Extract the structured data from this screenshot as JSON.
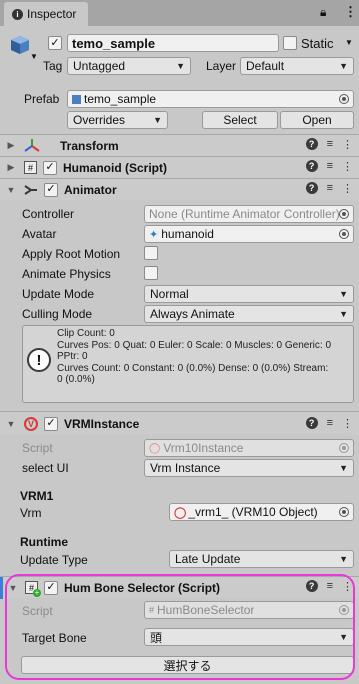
{
  "tab": {
    "title": "Inspector"
  },
  "object": {
    "name": "temo_sample",
    "static_label": "Static",
    "tag_label": "Tag",
    "tag_value": "Untagged",
    "layer_label": "Layer",
    "layer_value": "Default",
    "prefab_label": "Prefab",
    "prefab_value": "temo_sample",
    "overrides": "Overrides",
    "select": "Select",
    "open": "Open"
  },
  "components": {
    "transform": "Transform",
    "humanoid": "Humanoid (Script)",
    "animator": {
      "title": "Animator",
      "controller_label": "Controller",
      "controller_value": "None (Runtime Animator Controller)",
      "avatar_label": "Avatar",
      "avatar_value": "humanoid",
      "apply_root_label": "Apply Root Motion",
      "animate_physics_label": "Animate Physics",
      "update_mode_label": "Update Mode",
      "update_mode_value": "Normal",
      "culling_label": "Culling Mode",
      "culling_value": "Always Animate",
      "info": [
        "Clip Count: 0",
        "Curves Pos: 0 Quat: 0 Euler: 0 Scale: 0 Muscles: 0 Generic: 0",
        "PPtr: 0",
        "Curves Count: 0 Constant: 0 (0.0%) Dense: 0 (0.0%) Stream:",
        "0 (0.0%)"
      ]
    },
    "vrm": {
      "title": "VRMInstance",
      "script_label": "Script",
      "script_value": "Vrm10Instance",
      "select_ui_label": "select UI",
      "select_ui_value": "Vrm Instance",
      "section_vrm1": "VRM1",
      "vrm_label": "Vrm",
      "vrm_value": "_vrm1_ (VRM10 Object)",
      "section_runtime": "Runtime",
      "update_type_label": "Update Type",
      "update_type_value": "Late Update"
    },
    "hum_bone": {
      "title": "Hum Bone Selector (Script)",
      "script_label": "Script",
      "script_value": "HumBoneSelector",
      "target_label": "Target Bone",
      "target_value": "頭",
      "button": "選択する"
    }
  },
  "colors": {
    "highlight": "#e838d8"
  }
}
